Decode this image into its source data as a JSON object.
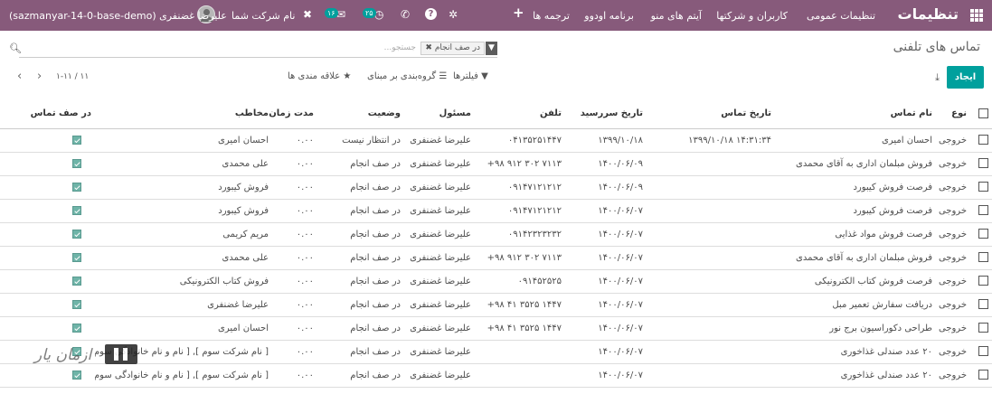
{
  "navbar": {
    "brand": "تنظیمات",
    "menu": [
      "تنظیمات عمومی",
      "کاربران و شرکتها",
      "آیتم های منو",
      "برنامه اودوو",
      "ترجمه ها"
    ],
    "plus": "+",
    "discuss_badge": "۱۶",
    "activity_badge": "۲۵",
    "company": "نام شرکت شما",
    "user": "علیرضا غضنفری (sazmanyar-14-0-base-demo)",
    "bg_color": "#875a7b"
  },
  "page": {
    "title": "تماس های تلفنی",
    "search_placeholder": "جستجو...",
    "facet": "در صف انجام",
    "create": "ایجاد",
    "filters": "فیلترها",
    "groupby": "گروه‌بندی بر مبنای",
    "favorites": "علاقه مندی ها",
    "pager": "۱-۱۱ / ۱۱",
    "accent_color": "#00a09d"
  },
  "table": {
    "headers": {
      "type": "نوع",
      "name": "نام تماس",
      "call_date": "تاریخ تماس",
      "deadline": "تاریخ سررسید",
      "phone": "تلفن",
      "owner": "مسئول",
      "status": "وضعیت",
      "duration": "مدت زمان",
      "contact": "مخاطب",
      "in_queue": "در صف تماس"
    },
    "rows": [
      {
        "type": "خروجی",
        "name": "احسان امیری",
        "call_date": "۱۳۹۹/۱۰/۱۸ ۱۴:۳۱:۳۴",
        "deadline": "۱۳۹۹/۱۰/۱۸",
        "phone": "۰۴۱۳۵۲۵۱۴۴۷",
        "owner": "علیرضا غضنفری",
        "status": "در انتظار نیست",
        "duration": "۰.۰۰",
        "contact": "احسان امیری"
      },
      {
        "type": "خروجی",
        "name": "فروش مبلمان اداری به آقای محمدی",
        "call_date": "",
        "deadline": "۱۴۰۰/۰۶/۰۹",
        "phone": "+۹۸ ۹۱۲ ۳۰۲ ۷۱۱۳",
        "owner": "علیرضا غضنفری",
        "status": "در صف انجام",
        "duration": "۰.۰۰",
        "contact": "علی محمدی"
      },
      {
        "type": "خروجی",
        "name": "فرصت فروش کیبورد",
        "call_date": "",
        "deadline": "۱۴۰۰/۰۶/۰۹",
        "phone": "۰۹۱۴۷۱۲۱۲۱۲",
        "owner": "علیرضا غضنفری",
        "status": "در صف انجام",
        "duration": "۰.۰۰",
        "contact": "فروش کیبورد"
      },
      {
        "type": "خروجی",
        "name": "فرصت فروش کیبورد",
        "call_date": "",
        "deadline": "۱۴۰۰/۰۶/۰۷",
        "phone": "۰۹۱۴۷۱۲۱۲۱۲",
        "owner": "علیرضا غضنفری",
        "status": "در صف انجام",
        "duration": "۰.۰۰",
        "contact": "فروش کیبورد"
      },
      {
        "type": "خروجی",
        "name": "فرصت فروش مواد غذایی",
        "call_date": "",
        "deadline": "۱۴۰۰/۰۶/۰۷",
        "phone": "۰۹۱۴۲۳۲۳۲۳۲",
        "owner": "علیرضا غضنفری",
        "status": "در صف انجام",
        "duration": "۰.۰۰",
        "contact": "مریم کریمی"
      },
      {
        "type": "خروجی",
        "name": "فروش مبلمان اداری به آقای محمدی",
        "call_date": "",
        "deadline": "۱۴۰۰/۰۶/۰۷",
        "phone": "+۹۸ ۹۱۲ ۳۰۲ ۷۱۱۳",
        "owner": "علیرضا غضنفری",
        "status": "در صف انجام",
        "duration": "۰.۰۰",
        "contact": "علی محمدی"
      },
      {
        "type": "خروجی",
        "name": "فرصت فروش کتاب الکترونیکی",
        "call_date": "",
        "deadline": "۱۴۰۰/۰۶/۰۷",
        "phone": "۰۹۱۴۵۲۵۲۵",
        "owner": "علیرضا غضنفری",
        "status": "در صف انجام",
        "duration": "۰.۰۰",
        "contact": "فروش کتاب الکترونیکی"
      },
      {
        "type": "خروجی",
        "name": "دریافت سفارش تعمیر مبل",
        "call_date": "",
        "deadline": "۱۴۰۰/۰۶/۰۷",
        "phone": "+۹۸ ۴۱ ۳۵۲۵ ۱۴۴۷",
        "owner": "علیرضا غضنفری",
        "status": "در صف انجام",
        "duration": "۰.۰۰",
        "contact": "علیرضا غضنفری"
      },
      {
        "type": "خروجی",
        "name": "طراحی دکوراسیون برج نور",
        "call_date": "",
        "deadline": "۱۴۰۰/۰۶/۰۷",
        "phone": "+۹۸ ۴۱ ۳۵۲۵ ۱۴۴۷",
        "owner": "علیرضا غضنفری",
        "status": "در صف انجام",
        "duration": "۰.۰۰",
        "contact": "احسان امیری"
      },
      {
        "type": "خروجی",
        "name": "۲۰ عدد صندلی غذاخوری",
        "call_date": "",
        "deadline": "۱۴۰۰/۰۶/۰۷",
        "phone": "",
        "owner": "علیرضا غضنفری",
        "status": "در صف انجام",
        "duration": "۰.۰۰",
        "contact": "[ نام شرکت سوم ], [ نام و نام خانوادگی سوم ]"
      },
      {
        "type": "خروجی",
        "name": "۲۰ عدد صندلی غذاخوری",
        "call_date": "",
        "deadline": "۱۴۰۰/۰۶/۰۷",
        "phone": "",
        "owner": "علیرضا غضنفری",
        "status": "در صف انجام",
        "duration": "۰.۰۰",
        "contact": "[ نام شرکت سوم ], [ نام و نام خانوادگی سوم ]"
      }
    ]
  },
  "watermark": {
    "text": "ازمان یار"
  }
}
